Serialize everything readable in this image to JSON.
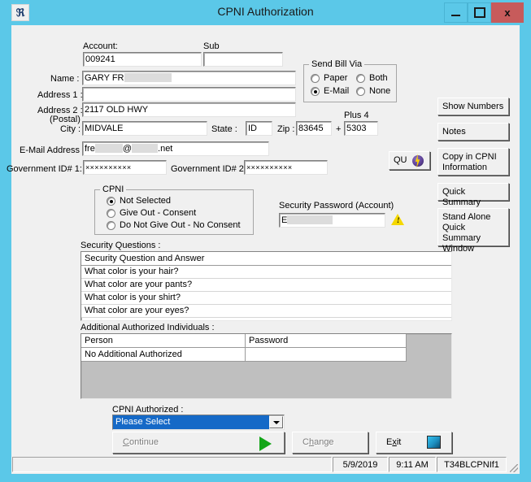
{
  "window": {
    "title": "CPNI Authorization",
    "icon": "app-icon",
    "minimize_label": "",
    "maximize_label": "",
    "close_label": "x"
  },
  "form": {
    "account_label": "Account:",
    "account_value": "009241",
    "sub_label": "Sub",
    "sub_value": "",
    "name_label": "Name :",
    "name_value": "GARY  FR",
    "address1_label": "Address 1 :",
    "address1_value": "",
    "address2_label": "Address 2 :",
    "address2_sub_label": "(Postal)",
    "address2_value": "2117 OLD HWY",
    "city_label": "City :",
    "city_value": "MIDVALE",
    "state_label": "State :",
    "state_value": "ID",
    "zip_label": "Zip :",
    "zip_value": "83645",
    "plus_sign": "+",
    "plus4_label": "Plus 4",
    "plus4_value": "5303",
    "email_label": "E-Mail Address :",
    "email_prefix": "fre",
    "email_at": "@",
    "email_suffix": ".net",
    "govid1_label": "Government ID# 1:",
    "govid1_value": "××××××××××",
    "govid2_label": "Government ID# 2 :",
    "govid2_value": "××××××××××",
    "qu_button_label": "QU"
  },
  "send_bill_via": {
    "title": "Send Bill Via",
    "options": [
      {
        "label": "Paper",
        "selected": false
      },
      {
        "label": "Both",
        "selected": false
      },
      {
        "label": "E-Mail",
        "selected": true
      },
      {
        "label": "None",
        "selected": false
      }
    ]
  },
  "side_buttons": [
    {
      "label": "Show Numbers"
    },
    {
      "label": "Notes"
    },
    {
      "label": "Copy in CPNI\nInformation"
    },
    {
      "label": "Quick Summary"
    },
    {
      "label": "Stand Alone\nQuick Summary\nWindow"
    }
  ],
  "cpni_group": {
    "title": "CPNI",
    "options": [
      {
        "label": "Not Selected",
        "selected": true
      },
      {
        "label": "Give Out - Consent",
        "selected": false
      },
      {
        "label": "Do Not Give Out - No Consent",
        "selected": false
      }
    ]
  },
  "security_password": {
    "label": "Security Password (Account)",
    "value": "E"
  },
  "security_questions": {
    "label": "Security Questions :",
    "header": "Security Question and Answer",
    "rows": [
      "What color is your hair?",
      "What color are your pants?",
      "What color is your shirt?",
      "What color are your eyes?"
    ]
  },
  "additional_authorized": {
    "label": "Additional Authorized Individuals :",
    "columns": [
      "Person",
      "Password"
    ],
    "rows": [
      {
        "person": "No Additional Authorized",
        "password": ""
      }
    ]
  },
  "cpni_authorized": {
    "label": "CPNI Authorized :",
    "selected": "Please Select"
  },
  "actions": {
    "continue_label": "Continue",
    "continue_accel": "C",
    "change_label": "Change",
    "change_accel": "h",
    "exit_label": "Exit",
    "exit_accel": "x"
  },
  "statusbar": {
    "left": "",
    "date": "5/9/2019",
    "time": "9:11 AM",
    "code": "T34BLCPNIf1"
  },
  "colors": {
    "window_frame": "#5bc8e8",
    "client_bg": "#f0f0f0",
    "close_button": "#c75b5b",
    "combo_highlight": "#1569c7",
    "grid_empty": "#bfbfbf",
    "green_arrow": "#13a518",
    "warning_yellow": "#f5d800"
  }
}
